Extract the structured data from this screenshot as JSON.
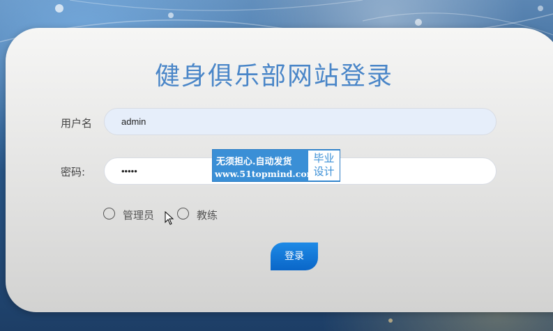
{
  "page": {
    "title": "健身俱乐部网站登录"
  },
  "form": {
    "username_label": "用户名",
    "username_value": "admin",
    "password_label": "密码:",
    "password_value": "•••••",
    "roles": [
      {
        "label": "管理员",
        "selected": false
      },
      {
        "label": "教练",
        "selected": false
      }
    ],
    "login_button": "登录"
  },
  "watermark": {
    "line1": "无须担心.自动发货",
    "line2": "www.51topmind.com",
    "badge_line1": "毕业",
    "badge_line2": "设计"
  },
  "colors": {
    "title": "#4a86c8",
    "button": "#0a66c8",
    "watermark": "#3a8fd6"
  }
}
